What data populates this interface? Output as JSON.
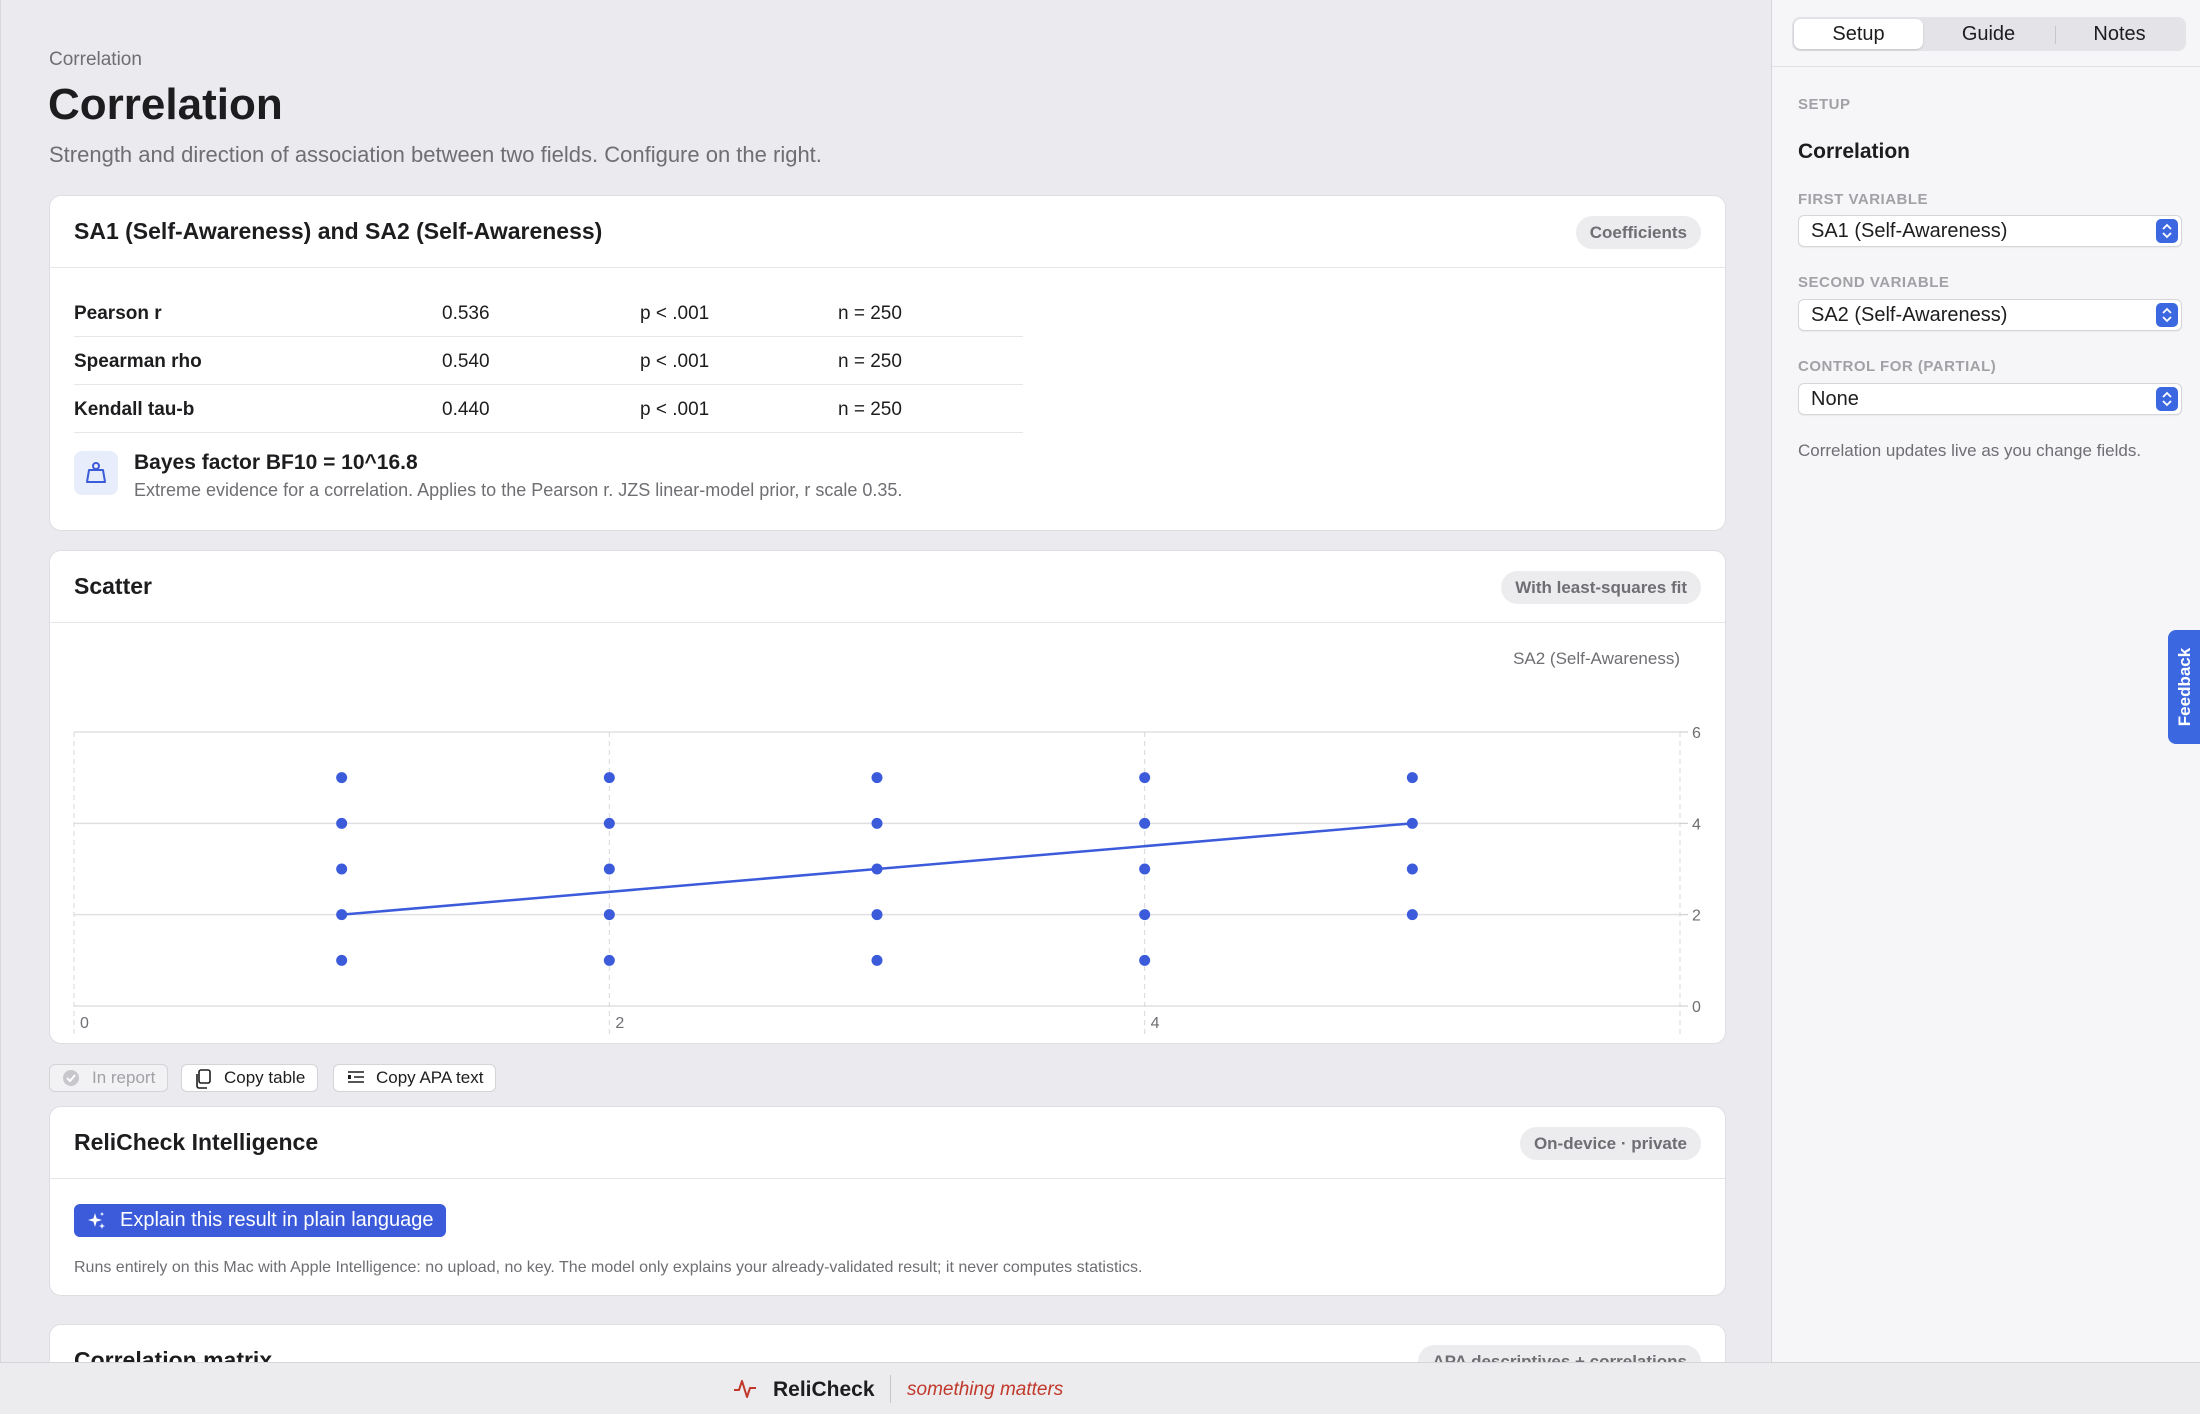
{
  "breadcrumb": "Correlation",
  "page": {
    "title": "Correlation",
    "subtitle": "Strength and direction of association between two fields. Configure on the right."
  },
  "coefficients": {
    "title": "SA1 (Self-Awareness) and SA2 (Self-Awareness)",
    "badge": "Coefficients",
    "rows": [
      {
        "name": "Pearson r",
        "value": "0.536",
        "p": "p < .001",
        "n": "n = 250"
      },
      {
        "name": "Spearman rho",
        "value": "0.540",
        "p": "p < .001",
        "n": "n = 250"
      },
      {
        "name": "Kendall tau-b",
        "value": "0.440",
        "p": "p < .001",
        "n": "n = 250"
      }
    ],
    "bayes_title": "Bayes factor BF10 = 10^16.8",
    "bayes_desc": "Extreme evidence for a correlation. Applies to the Pearson r. JZS linear-model prior, r scale 0.35.",
    "bayes_icon": "weight-icon"
  },
  "scatter": {
    "title": "Scatter",
    "badge": "With least-squares fit"
  },
  "chart_data": {
    "type": "scatter",
    "title": "",
    "xlabel": "SA1 (Self-Awareness)",
    "ylabel": "SA2 (Self-Awareness)",
    "xlim": [
      0,
      6
    ],
    "ylim": [
      0,
      6
    ],
    "x_ticks": [
      0,
      2,
      4
    ],
    "y_ticks": [
      0,
      2,
      4,
      6
    ],
    "grid": true,
    "points": [
      {
        "x": 1,
        "y": 1
      },
      {
        "x": 1,
        "y": 2
      },
      {
        "x": 1,
        "y": 3
      },
      {
        "x": 1,
        "y": 4
      },
      {
        "x": 1,
        "y": 5
      },
      {
        "x": 2,
        "y": 1
      },
      {
        "x": 2,
        "y": 2
      },
      {
        "x": 2,
        "y": 3
      },
      {
        "x": 2,
        "y": 4
      },
      {
        "x": 2,
        "y": 5
      },
      {
        "x": 3,
        "y": 1
      },
      {
        "x": 3,
        "y": 2
      },
      {
        "x": 3,
        "y": 3
      },
      {
        "x": 3,
        "y": 4
      },
      {
        "x": 3,
        "y": 5
      },
      {
        "x": 4,
        "y": 1
      },
      {
        "x": 4,
        "y": 2
      },
      {
        "x": 4,
        "y": 3
      },
      {
        "x": 4,
        "y": 4
      },
      {
        "x": 4,
        "y": 5
      },
      {
        "x": 5,
        "y": 2
      },
      {
        "x": 5,
        "y": 3
      },
      {
        "x": 5,
        "y": 4
      },
      {
        "x": 5,
        "y": 5
      }
    ],
    "fit_line": {
      "x": [
        1,
        5
      ],
      "y": [
        2,
        4
      ]
    },
    "point_color": "#3b5bdb"
  },
  "actions": {
    "in_report": "In report",
    "copy_table": "Copy table",
    "copy_apa": "Copy APA text"
  },
  "intelligence": {
    "title": "ReliCheck Intelligence",
    "badge": "On-device · private",
    "button": "Explain this result in plain language",
    "note": "Runs entirely on this Mac with Apple Intelligence: no upload, no key. The model only explains your already-validated result; it never computes statistics."
  },
  "matrix": {
    "title": "Correlation matrix",
    "badge": "APA descriptives + correlations"
  },
  "footer": {
    "brand": "ReliCheck",
    "tagline": "something matters"
  },
  "panel": {
    "tabs": [
      "Setup",
      "Guide",
      "Notes"
    ],
    "section": "SETUP",
    "title": "Correlation",
    "first_label": "FIRST VARIABLE",
    "first_value": "SA1 (Self-Awareness)",
    "second_label": "SECOND VARIABLE",
    "second_value": "SA2 (Self-Awareness)",
    "control_label": "CONTROL FOR (PARTIAL)",
    "control_value": "None",
    "note": "Correlation updates live as you change fields.",
    "feedback": "Feedback"
  },
  "colors": {
    "accent": "#3b5bdb",
    "tagline": "#c0392b"
  }
}
